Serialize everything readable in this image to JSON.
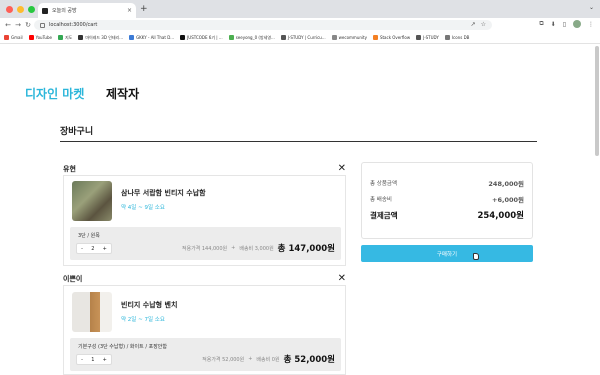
{
  "browser": {
    "tab_title": "오늘의 공방",
    "tab_close": "×",
    "new_tab": "+",
    "tab_dropdown": "⌄",
    "address": "localhost:3000/cart",
    "nav": {
      "back": "←",
      "forward": "→",
      "reload": "↻"
    },
    "omni_tools": [
      "↗",
      "☆"
    ],
    "right_tools": [
      "⧉",
      "⬇",
      "▯",
      "⋮"
    ],
    "bookmarks": [
      {
        "label": "Gmail",
        "color": "#ea4335"
      },
      {
        "label": "YouTube",
        "color": "#ff0000"
      },
      {
        "label": "지도",
        "color": "#34a853"
      },
      {
        "label": "마이레드 3D 인테리...",
        "color": "#333333"
      },
      {
        "label": "GKKY - All That D...",
        "color": "#3c7bd6"
      },
      {
        "label": "JUSTCODE 6기 | ...",
        "color": "#111111"
      },
      {
        "label": "seeyong_0 (방세영...",
        "color": "#4caf50"
      },
      {
        "label": "J-STUDY | Curricu...",
        "color": "#555555"
      },
      {
        "label": "wecommunity",
        "color": "#888888"
      },
      {
        "label": "Stack Overflow",
        "color": "#f48024"
      },
      {
        "label": "J-STUDY",
        "color": "#555555"
      },
      {
        "label": "Icons DB",
        "color": "#777777"
      }
    ]
  },
  "header": {
    "brand": "디자인 마켓",
    "maker": "제작자"
  },
  "cart": {
    "title": "장바구니",
    "groups": [
      {
        "seller": "유현",
        "close": "✕",
        "item_name": "삼나무 서랍함 빈티지 수납함",
        "shipping": "약 4일 ~ 9일 소요",
        "option": "3단 / 원목",
        "qty": "2",
        "minus": "-",
        "plus": "+",
        "price_text": "적용가격 144,000원",
        "sep": "+",
        "ship_text": "배송비 3,000원",
        "total": "총 147,000원"
      },
      {
        "seller": "이쁜이",
        "close": "✕",
        "item_name": "빈티지 수납형 벤치",
        "shipping": "약 2일 ~ 7일 소요",
        "option": "기본구성 (3단 수납형) / 화이트 / 포장안함",
        "qty": "1",
        "minus": "-",
        "plus": "+",
        "price_text": "적용가격 52,000원",
        "sep": "+",
        "ship_text": "배송비 0원",
        "total": "총 52,000원"
      }
    ]
  },
  "summary": {
    "product_label": "총 상품금액",
    "product_value": "248,000원",
    "ship_label": "총 배송비",
    "ship_value": "+6,000원",
    "pay_label": "결제금액",
    "pay_value": "254,000원",
    "buy_button": "구매하기"
  }
}
